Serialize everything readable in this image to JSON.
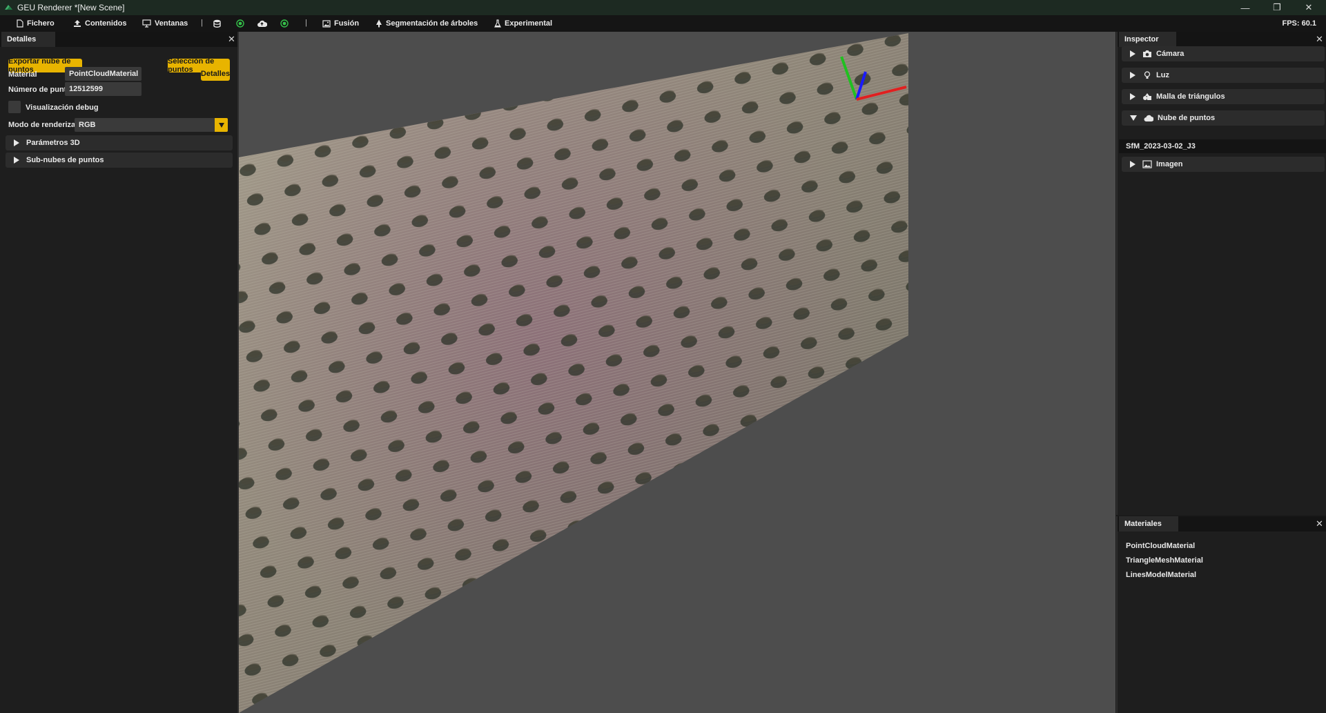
{
  "window": {
    "title": "GEU Renderer *[New Scene]",
    "minimize_glyph": "—",
    "restore_glyph": "❐",
    "close_glyph": "✕"
  },
  "menu": {
    "items": [
      {
        "label": "Fichero",
        "icon": "file-icon"
      },
      {
        "label": "Contenidos",
        "icon": "upload-icon"
      },
      {
        "label": "Ventanas",
        "icon": "monitor-icon"
      },
      {
        "label": "Fusión",
        "icon": "image-icon"
      },
      {
        "label": "Segmentación de árboles",
        "icon": "tree-icon"
      },
      {
        "label": "Experimental",
        "icon": "flask-icon"
      }
    ],
    "separator": "|",
    "status_icons": [
      "database-icon",
      "record-icon",
      "cloud-icon",
      "record-icon"
    ],
    "fps": "FPS: 60.1"
  },
  "details": {
    "tab": "Detalles",
    "close": "✕",
    "export_button": "Exportar nube de puntos",
    "select_button": "Selección de puntos",
    "material_label": "Material",
    "material_value": "PointCloudMaterial",
    "details_button": "Detalles",
    "points_label": "Número de puntos",
    "points_value": "12512599",
    "debug_label": "Visualización debug",
    "debug_checked": false,
    "render_mode_label": "Modo de renderizado",
    "render_mode_value": "RGB",
    "params3d": "Parámetros 3D",
    "subclouds": "Sub-nubes de puntos"
  },
  "inspector": {
    "tab": "Inspector",
    "close": "✕",
    "items": [
      {
        "label": "Cámara",
        "icon": "camera-icon",
        "expanded": false
      },
      {
        "label": "Luz",
        "icon": "lightbulb-icon",
        "expanded": false
      },
      {
        "label": "Malla de triángulos",
        "icon": "shapes-icon",
        "expanded": false
      },
      {
        "label": "Nube de puntos",
        "icon": "cloud-icon",
        "expanded": true
      },
      {
        "label": "Imagen",
        "icon": "image-icon",
        "expanded": false
      }
    ],
    "pointcloud_child": "SfM_2023-03-02_J3"
  },
  "materials": {
    "tab": "Materiales",
    "close": "✕",
    "items": [
      "PointCloudMaterial",
      "TriangleMeshMaterial",
      "LinesModelMaterial"
    ]
  },
  "colors": {
    "accent": "#e8b400",
    "viewport_bg": "#4d4d4d",
    "axis_x": "#e02020",
    "axis_y": "#20c020",
    "axis_z": "#1a1aff"
  }
}
